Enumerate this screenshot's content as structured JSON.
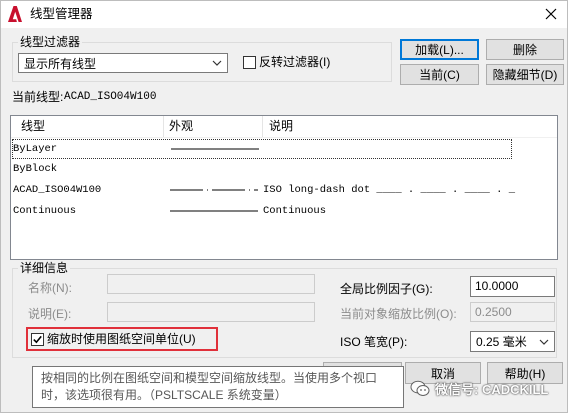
{
  "window": {
    "title": "线型管理器"
  },
  "filter": {
    "group_label": "线型过滤器",
    "dropdown_value": "显示所有线型",
    "invert_label": "反转过滤器(I)",
    "invert_checked": false
  },
  "buttons": {
    "load": "加载(L)...",
    "delete": "删除",
    "current": "当前(C)",
    "hide_details": "隐藏细节(D)",
    "cancel": "取消",
    "help": "帮助(H)"
  },
  "current_linetype": {
    "label": "当前线型:",
    "value": "ACAD_ISO04W100"
  },
  "list": {
    "columns": [
      "线型",
      "外观",
      "说明"
    ],
    "rows": [
      {
        "name": "ByLayer",
        "appearance_icon": "solid-line",
        "description": "",
        "selected": true
      },
      {
        "name": "ByBlock",
        "appearance_icon": "",
        "description": "",
        "selected": false
      },
      {
        "name": "ACAD_ISO04W100",
        "appearance_icon": "long-dash-dot-line",
        "description": "ISO long-dash dot ____ . ____ . ____ . _",
        "selected": false
      },
      {
        "name": "Continuous",
        "appearance_icon": "solid-line",
        "description": "Continuous",
        "selected": false
      }
    ]
  },
  "details": {
    "group_label": "详细信息",
    "name_label": "名称(N):",
    "desc_label": "说明(E):",
    "paper_space_label": "缩放时使用图纸空间单位(U)",
    "paper_space_checked": true,
    "global_scale_label": "全局比例因子(G):",
    "global_scale_value": "10.0000",
    "object_scale_label": "当前对象缩放比例(O):",
    "object_scale_value": "0.2500",
    "iso_pen_label": "ISO 笔宽(P):",
    "iso_pen_value": "0.25 毫米"
  },
  "tooltip": {
    "line1": "按相同的比例在图纸空间和模型空间缩放线型。当使用多个视口",
    "line2": "时，该选项很有用。（PSLTSCALE 系统变量）"
  },
  "watermark": {
    "text": "微信号: CADCKILL"
  },
  "colors": {
    "highlight": "#e0303a",
    "focus": "#0078d7",
    "logo": "#c8102e"
  }
}
